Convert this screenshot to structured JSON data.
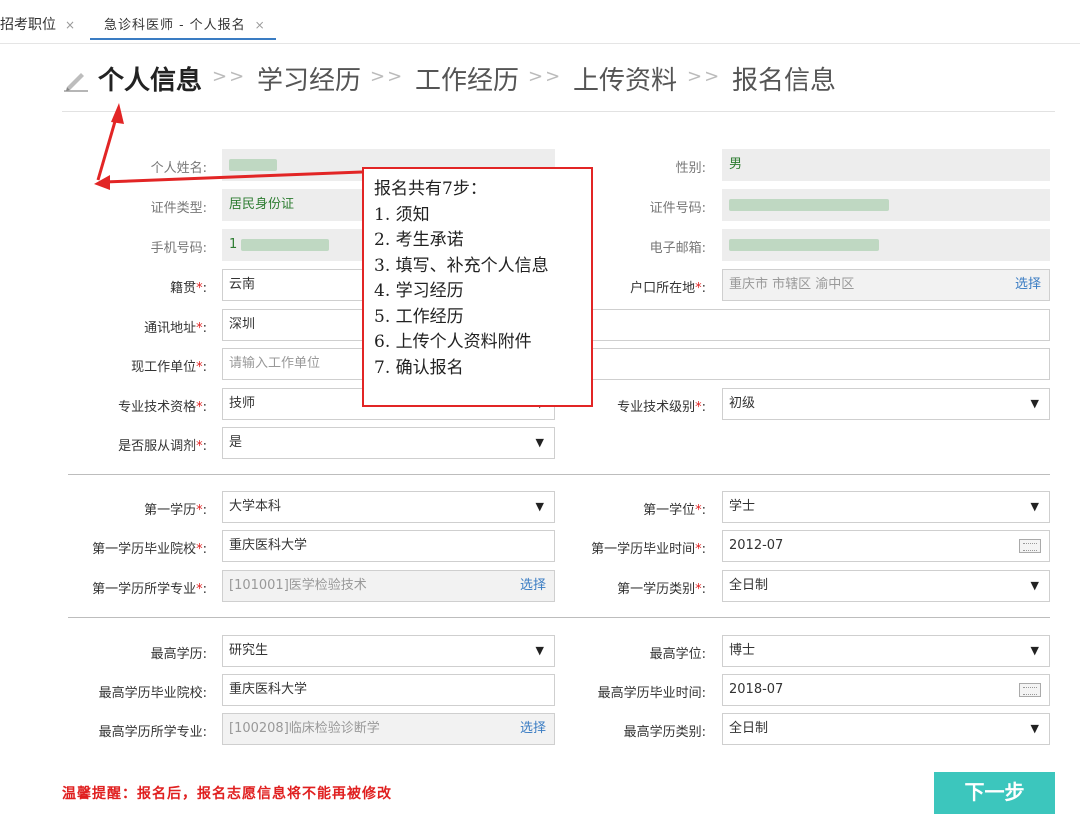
{
  "tabs": [
    {
      "label": "招考职位",
      "close": "×"
    },
    {
      "label": "急诊科医师 - 个人报名",
      "close": "×"
    }
  ],
  "steps": {
    "items": [
      "个人信息",
      "学习经历",
      "工作经历",
      "上传资料",
      "报名信息"
    ],
    "separator": ">>",
    "active_index": 0,
    "active_icon": "pencil-icon"
  },
  "personal": {
    "name_label": "个人姓名:",
    "gender_label": "性别:",
    "gender_value": "男",
    "id_type_label": "证件类型:",
    "id_type_value": "居民身份证",
    "id_number_label": "证件号码:",
    "phone_label": "手机号码:",
    "phone_value": "1",
    "email_label": "电子邮箱:",
    "native_label": "籍贯",
    "native_value": "云南",
    "hukou_label": "户口所在地",
    "hukou_placeholder": "重庆市 市辖区 渝中区",
    "hukou_pick": "选择",
    "address_label": "通讯地址",
    "address_value": "深圳",
    "employer_label": "现工作单位",
    "employer_placeholder": "请输入工作单位",
    "qualification_label": "专业技术资格",
    "qualification_value": "技师",
    "level_label": "专业技术级别",
    "level_value": "初级",
    "adjust_label": "是否服从调剂",
    "adjust_value": "是"
  },
  "first_edu": {
    "degree_label": "第一学历",
    "degree_value": "大学本科",
    "title_label": "第一学位",
    "title_value": "学士",
    "school_label": "第一学历毕业院校",
    "school_value": "重庆医科大学",
    "grad_time_label": "第一学历毕业时间",
    "grad_time_value": "2012-07",
    "major_label": "第一学历所学专业",
    "major_value": "[101001]医学检验技术",
    "major_pick": "选择",
    "type_label": "第一学历类别",
    "type_value": "全日制"
  },
  "highest_edu": {
    "degree_label": "最高学历:",
    "degree_value": "研究生",
    "title_label": "最高学位:",
    "title_value": "博士",
    "school_label": "最高学历毕业院校:",
    "school_value": "重庆医科大学",
    "grad_time_label": "最高学历毕业时间:",
    "grad_time_value": "2018-07",
    "major_label": "最高学历所学专业:",
    "major_value": "[100208]临床检验诊断学",
    "major_pick": "选择",
    "type_label": "最高学历类别:",
    "type_value": "全日制"
  },
  "required_mark": "*",
  "colon": ":",
  "annotation": {
    "title": "报名共有7步：",
    "items": [
      "1. 须知",
      "2. 考生承诺",
      "3. 填写、补充个人信息",
      "4. 学习经历",
      "5. 工作经历",
      "6. 上传个人资料附件",
      "7. 确认报名"
    ]
  },
  "footer": {
    "tip": "温馨提醒：报名后，报名志愿信息将不能再被修改",
    "next_label": "下一步"
  },
  "colors": {
    "accent": "#3a7cc3",
    "button": "#3cc6bd",
    "required": "#e02020",
    "annotation_border": "#e22525"
  }
}
